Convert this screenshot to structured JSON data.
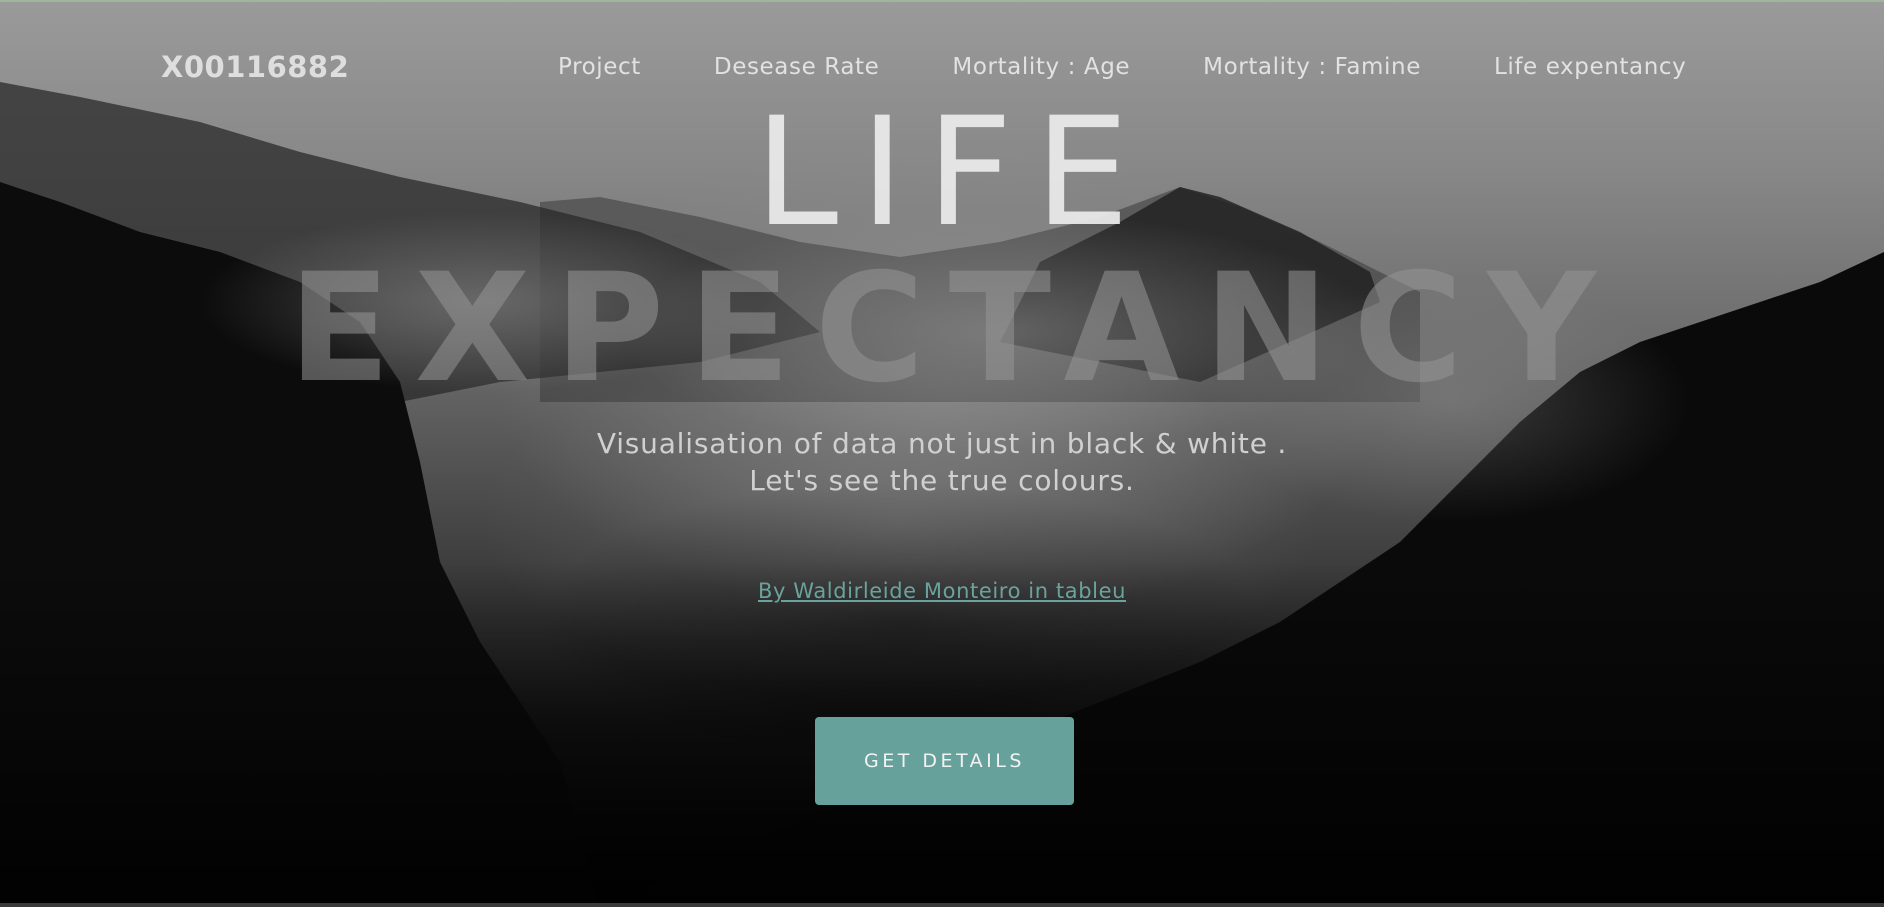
{
  "brand": "X00116882",
  "nav": {
    "items": [
      {
        "label": "Project"
      },
      {
        "label": "Desease Rate"
      },
      {
        "label": "Mortality : Age"
      },
      {
        "label": "Mortality : Famine"
      },
      {
        "label": "Life expentancy"
      }
    ]
  },
  "hero": {
    "title_line1": "LIFE",
    "title_line2": "EXPECTANCY",
    "subtitle_line1": "Visualisation of data not just in black & white .",
    "subtitle_line2": "Let's see the true colours.",
    "author_link": "By Waldirleide Monteiro in tableu",
    "cta_label": "GET DETAILS"
  },
  "colors": {
    "accent": "#66a19b",
    "link": "#6aa39d",
    "top_border": "#9fb59c"
  }
}
